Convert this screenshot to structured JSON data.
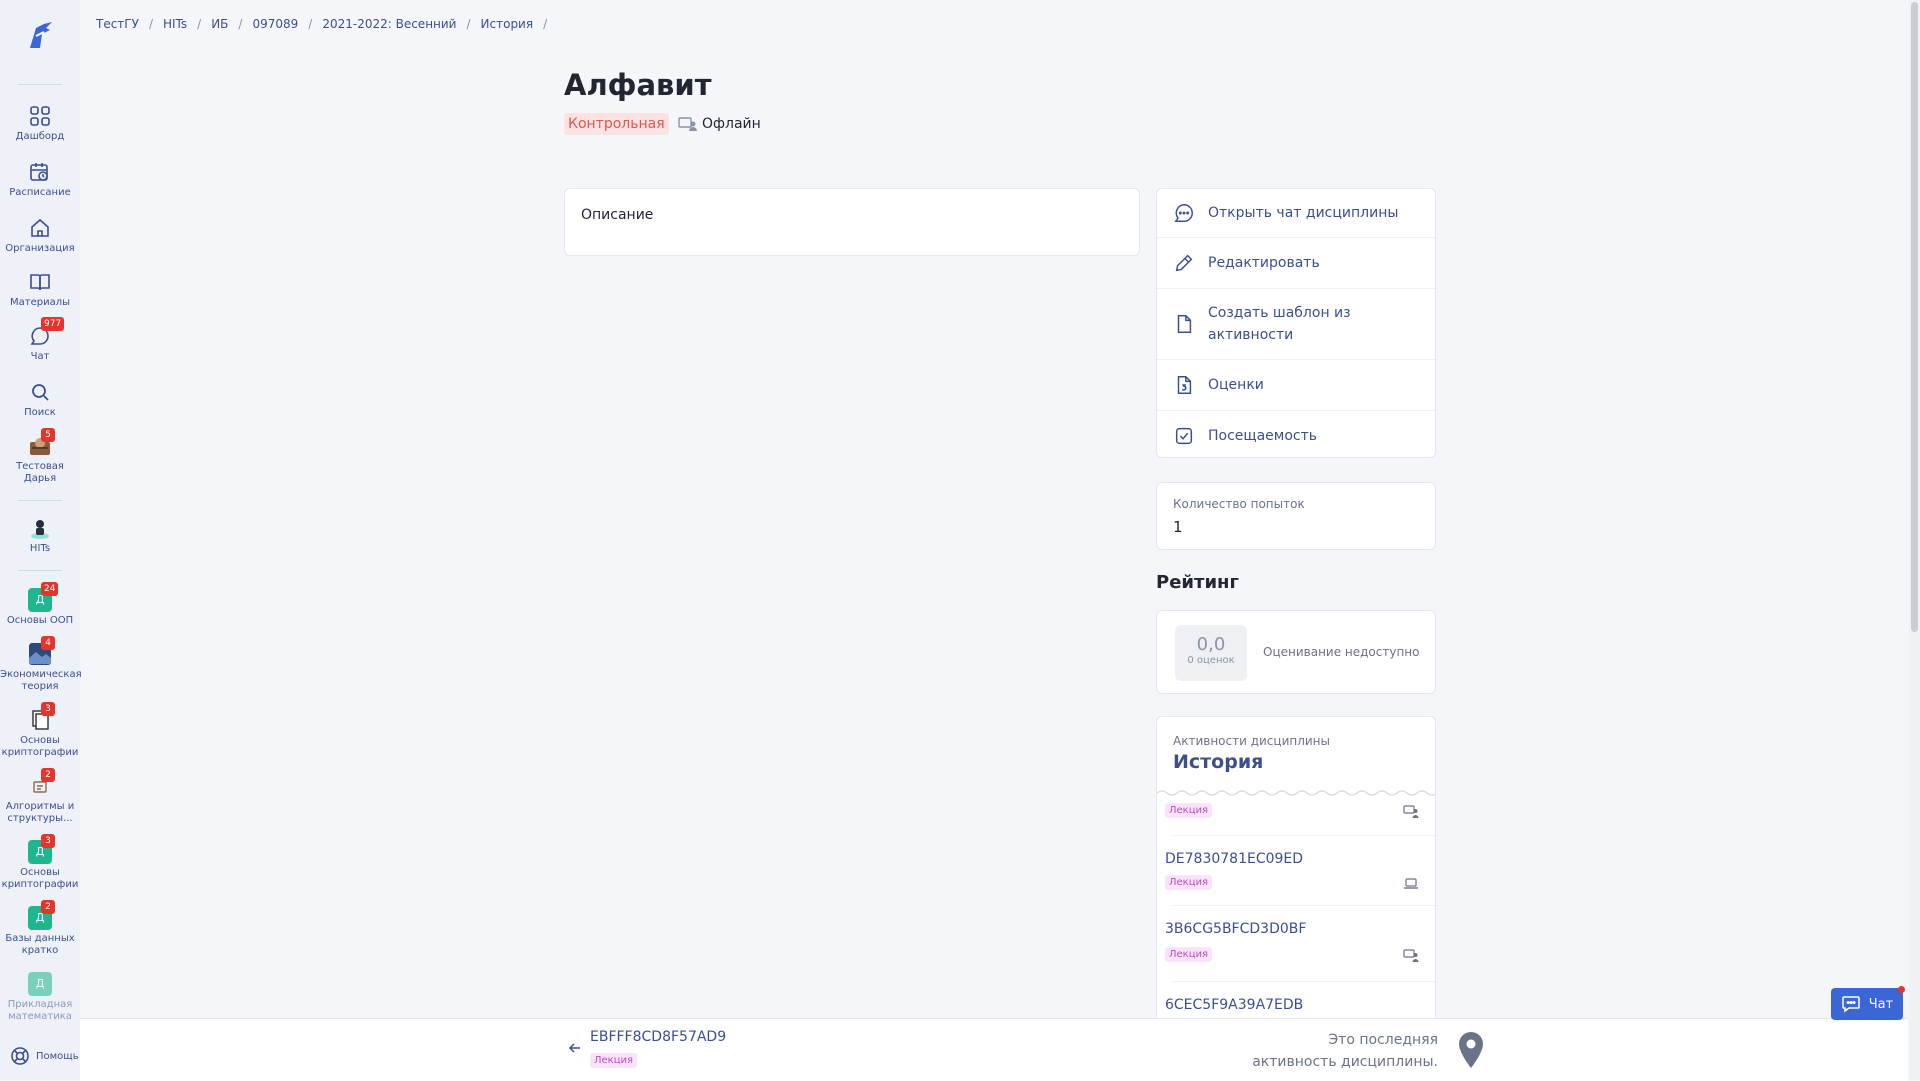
{
  "sidebar": {
    "items": [
      {
        "label": "Дашборд"
      },
      {
        "label": "Расписание"
      },
      {
        "label": "Организация"
      },
      {
        "label": "Материалы"
      },
      {
        "label": "Чат",
        "badge": "977"
      },
      {
        "label": "Поиск"
      },
      {
        "label": "Тестовая Дарья",
        "badge": "5"
      },
      {
        "label": "HITs"
      }
    ],
    "courses": [
      {
        "label": "Основы ООП",
        "icon_letter": "Д",
        "badge": "24"
      },
      {
        "label": "Экономическая теория",
        "badge": "4"
      },
      {
        "label": "Основы криптографии",
        "badge": "3"
      },
      {
        "label": "Алгоритмы и структуры...",
        "badge": "2"
      },
      {
        "label": "Основы криптографии",
        "icon_letter": "Д",
        "badge": "3"
      },
      {
        "label": "Базы данных кратко",
        "icon_letter": "Д",
        "badge": "2"
      },
      {
        "label": "Прикладная математика",
        "icon_letter": "Д"
      }
    ],
    "help_label": "Помощь"
  },
  "breadcrumb": [
    "ТестГУ",
    "HITs",
    "ИБ",
    "097089",
    "2021-2022: Весенний",
    "История"
  ],
  "header": {
    "title": "Алфавит",
    "type_badge": "Контрольная",
    "mode_label": "Офлайн"
  },
  "description": {
    "label": "Описание"
  },
  "actions": [
    {
      "label": "Открыть чат дисциплины",
      "icon": "chat-icon"
    },
    {
      "label": "Редактировать",
      "icon": "pencil-icon"
    },
    {
      "label": "Создать шаблон из активности",
      "icon": "document-icon"
    },
    {
      "label": "Оценки",
      "icon": "grade-icon"
    },
    {
      "label": "Посещаемость",
      "icon": "checkbox-icon"
    }
  ],
  "attempts": {
    "label": "Количество попыток",
    "value": "1"
  },
  "rating": {
    "title": "Рейтинг",
    "score": "0,0",
    "score_sub": "0 оценок",
    "note": "Оценивание недоступно"
  },
  "activities": {
    "label": "Активности дисциплины",
    "title": "История",
    "items": [
      {
        "title": "",
        "badge": "Лекция",
        "mode": "offline-icon"
      },
      {
        "title": "DE7830781EC09ED",
        "badge": "Лекция",
        "mode": "online-icon"
      },
      {
        "title": "3B6CG5BFCD3D0BF",
        "badge": "Лекция",
        "mode": "offline-icon"
      },
      {
        "title": "6CEC5F9A39A7EDB",
        "badge": "",
        "mode": ""
      }
    ]
  },
  "bottom": {
    "prev_title": "EBFFF8CD8F57AD9",
    "prev_badge": "Лекция",
    "last_note": "Это последняя активность дисциплины."
  },
  "chat_button": {
    "label": "Чат"
  },
  "colors": {
    "accent": "#3b4f8f",
    "danger": "#e5342c",
    "course_green": "#1fb58f",
    "chat_blue": "#3b66d6"
  }
}
